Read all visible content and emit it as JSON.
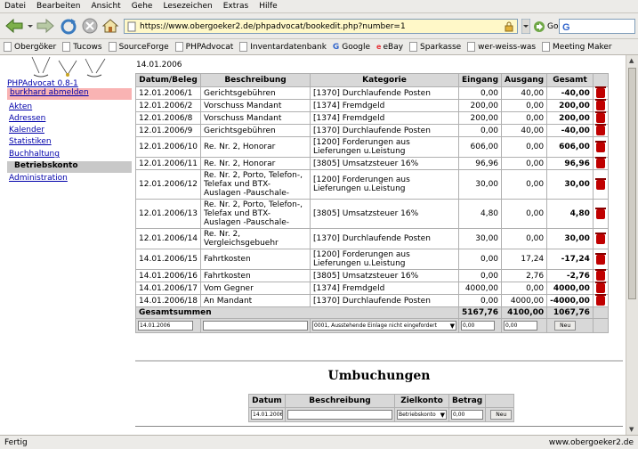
{
  "menu": [
    "Datei",
    "Bearbeiten",
    "Ansicht",
    "Gehe",
    "Lesezeichen",
    "Extras",
    "Hilfe"
  ],
  "url": "https://www.obergoeker2.de/phpadvocat/bookedit.php?number=1",
  "go_label": "Go",
  "bookmarks": [
    "Obergöker",
    "Tucows",
    "SourceForge",
    "PHPAdvocat",
    "Inventardatenbank",
    "Google",
    "eBay",
    "Sparkasse",
    "wer-weiss-was",
    "Meeting Maker"
  ],
  "sidebar": {
    "app_name": "PHPAdvocat 0.8-1",
    "logout": "burkhard abmelden",
    "links": [
      "Akten",
      "Adressen",
      "Kalender",
      "Statistiken",
      "Buchhaltung"
    ],
    "active": "Betriebskonto",
    "admin": "Administration"
  },
  "page_date": "14.01.2006",
  "table": {
    "headers": [
      "Datum/Beleg",
      "Beschreibung",
      "Kategorie",
      "Eingang",
      "Ausgang",
      "Gesamt"
    ],
    "rows": [
      {
        "beleg": "12.01.2006/1",
        "desc": "Gerichtsgebühren",
        "cat": "[1370] Durchlaufende Posten",
        "ein": "0,00",
        "aus": "40,00",
        "ges": "-40,00"
      },
      {
        "beleg": "12.01.2006/2",
        "desc": "Vorschuss Mandant",
        "cat": "[1374] Fremdgeld",
        "ein": "200,00",
        "aus": "0,00",
        "ges": "200,00"
      },
      {
        "beleg": "12.01.2006/8",
        "desc": "Vorschuss Mandant",
        "cat": "[1374] Fremdgeld",
        "ein": "200,00",
        "aus": "0,00",
        "ges": "200,00"
      },
      {
        "beleg": "12.01.2006/9",
        "desc": "Gerichtsgebühren",
        "cat": "[1370] Durchlaufende Posten",
        "ein": "0,00",
        "aus": "40,00",
        "ges": "-40,00"
      },
      {
        "beleg": "12.01.2006/10",
        "desc": "Re. Nr. 2, Honorar",
        "cat": "[1200] Forderungen aus Lieferungen u.Leistung",
        "ein": "606,00",
        "aus": "0,00",
        "ges": "606,00"
      },
      {
        "beleg": "12.01.2006/11",
        "desc": "Re. Nr. 2, Honorar",
        "cat": "[3805] Umsatzsteuer 16%",
        "ein": "96,96",
        "aus": "0,00",
        "ges": "96,96"
      },
      {
        "beleg": "12.01.2006/12",
        "desc": "Re. Nr. 2, Porto, Telefon-, Telefax und BTX-Auslagen -Pauschale-",
        "cat": "[1200] Forderungen aus Lieferungen u.Leistung",
        "ein": "30,00",
        "aus": "0,00",
        "ges": "30,00"
      },
      {
        "beleg": "12.01.2006/13",
        "desc": "Re. Nr. 2, Porto, Telefon-, Telefax und BTX-Auslagen -Pauschale-",
        "cat": "[3805] Umsatzsteuer 16%",
        "ein": "4,80",
        "aus": "0,00",
        "ges": "4,80"
      },
      {
        "beleg": "12.01.2006/14",
        "desc": "Re. Nr. 2, Vergleichsgebuehr",
        "cat": "[1370] Durchlaufende Posten",
        "ein": "30,00",
        "aus": "0,00",
        "ges": "30,00"
      },
      {
        "beleg": "14.01.2006/15",
        "desc": "Fahrtkosten",
        "cat": "[1200] Forderungen aus Lieferungen u.Leistung",
        "ein": "0,00",
        "aus": "17,24",
        "ges": "-17,24"
      },
      {
        "beleg": "14.01.2006/16",
        "desc": "Fahrtkosten",
        "cat": "[3805] Umsatzsteuer 16%",
        "ein": "0,00",
        "aus": "2,76",
        "ges": "-2,76"
      },
      {
        "beleg": "14.01.2006/17",
        "desc": "Vom Gegner",
        "cat": "[1374] Fremdgeld",
        "ein": "4000,00",
        "aus": "0,00",
        "ges": "4000,00"
      },
      {
        "beleg": "14.01.2006/18",
        "desc": "An Mandant",
        "cat": "[1370] Durchlaufende Posten",
        "ein": "0,00",
        "aus": "4000,00",
        "ges": "-4000,00"
      }
    ],
    "sum_label": "Gesamtsummen",
    "sum_ein": "5167,76",
    "sum_aus": "4100,00",
    "sum_ges": "1067,76",
    "input_date": "14.01.2006",
    "input_category": "0001, Ausstehende Einlage nicht eingefordert",
    "input_ein": "0,00",
    "input_aus": "0,00",
    "new_button": "Neu"
  },
  "umbuchungen": {
    "title": "Umbuchungen",
    "headers": [
      "Datum",
      "Beschreibung",
      "Zielkonto",
      "Betrag"
    ],
    "input_date": "14.01.2006",
    "input_konto": "Betriebskonto",
    "input_betrag": "0,00",
    "new_button": "Neu"
  },
  "status": {
    "left": "Fertig",
    "right": "www.obergoeker2.de"
  }
}
